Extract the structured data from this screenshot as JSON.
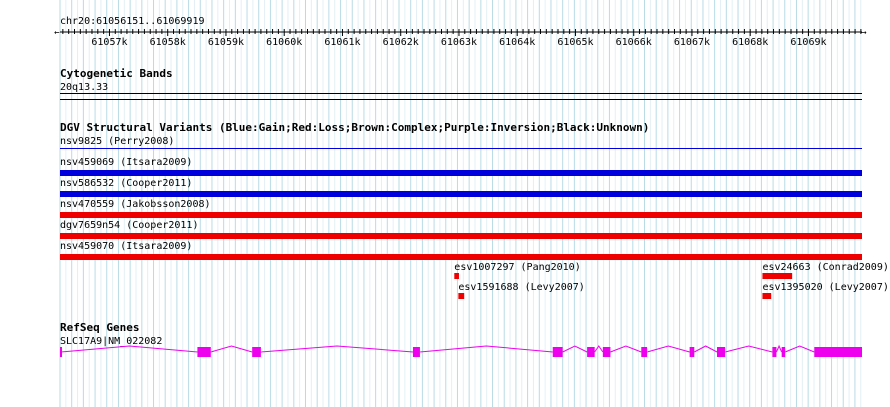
{
  "location": "chr20:61056151..61069919",
  "ruler": {
    "start": 61056151,
    "end": 61069919,
    "ticks": [
      {
        "pos": 61057000,
        "label": "61057k"
      },
      {
        "pos": 61058000,
        "label": "61058k"
      },
      {
        "pos": 61059000,
        "label": "61059k"
      },
      {
        "pos": 61060000,
        "label": "61060k"
      },
      {
        "pos": 61061000,
        "label": "61061k"
      },
      {
        "pos": 61062000,
        "label": "61062k"
      },
      {
        "pos": 61063000,
        "label": "61063k"
      },
      {
        "pos": 61064000,
        "label": "61064k"
      },
      {
        "pos": 61065000,
        "label": "61065k"
      },
      {
        "pos": 61066000,
        "label": "61066k"
      },
      {
        "pos": 61067000,
        "label": "61067k"
      },
      {
        "pos": 61068000,
        "label": "61068k"
      },
      {
        "pos": 61069000,
        "label": "61069k"
      }
    ]
  },
  "tracks": {
    "cytoband": {
      "title": "Cytogenetic Bands",
      "band": "20q13.33"
    },
    "dgv": {
      "title": "DGV Structural Variants (Blue:Gain;Red:Loss;Brown:Complex;Purple:Inversion;Black:Unknown)",
      "colors": {
        "gain": "#0000dd",
        "loss": "#ee0000"
      },
      "features": [
        {
          "id": "nsv9825",
          "label": "nsv9825 (Perry2008)",
          "type": "gain",
          "start": 61040000,
          "end": 61080000,
          "partial": true
        },
        {
          "id": "nsv459069",
          "label": "nsv459069 (Itsara2009)",
          "type": "gain",
          "start": 61040000,
          "end": 61080000
        },
        {
          "id": "nsv586532",
          "label": "nsv586532 (Cooper2011)",
          "type": "gain",
          "start": 61040000,
          "end": 61080000
        },
        {
          "id": "nsv470559",
          "label": "nsv470559 (Jakobsson2008)",
          "type": "loss",
          "start": 61040000,
          "end": 61080000
        },
        {
          "id": "dgv7659n54",
          "label": "dgv7659n54 (Cooper2011)",
          "type": "loss",
          "start": 61040000,
          "end": 61080000
        },
        {
          "id": "nsv459070",
          "label": "nsv459070 (Itsara2009)",
          "type": "loss",
          "start": 61040000,
          "end": 61080000
        }
      ],
      "small_features": [
        {
          "id": "esv1007297",
          "label": "esv1007297 (Pang2010)",
          "type": "loss",
          "start": 61062920,
          "end": 61063000
        },
        {
          "id": "esv1591688",
          "label": "esv1591688 (Levy2007)",
          "type": "loss",
          "start": 61062990,
          "end": 61063090
        },
        {
          "id": "esv24663",
          "label": "esv24663 (Conrad2009)",
          "type": "loss",
          "start": 61068210,
          "end": 61068720
        },
        {
          "id": "esv1395020",
          "label": "esv1395020 (Levy2007)",
          "type": "loss",
          "start": 61068210,
          "end": 61068360
        }
      ]
    },
    "refseq": {
      "title": "RefSeq Genes",
      "gene": "SLC17A9|NM_022082",
      "color": "#ee00ee",
      "start": 61056151,
      "end": 61069919,
      "exons": [
        [
          61056151,
          61056170
        ],
        [
          61058510,
          61058740
        ],
        [
          61059450,
          61059600
        ],
        [
          61062210,
          61062330
        ],
        [
          61064610,
          61064780
        ],
        [
          61065200,
          61065330
        ],
        [
          61065470,
          61065600
        ],
        [
          61066130,
          61066230
        ],
        [
          61066960,
          61067040
        ],
        [
          61067430,
          61067570
        ],
        [
          61068380,
          61068450
        ],
        [
          61068540,
          61068600
        ],
        [
          61069100,
          61069919
        ]
      ]
    }
  }
}
